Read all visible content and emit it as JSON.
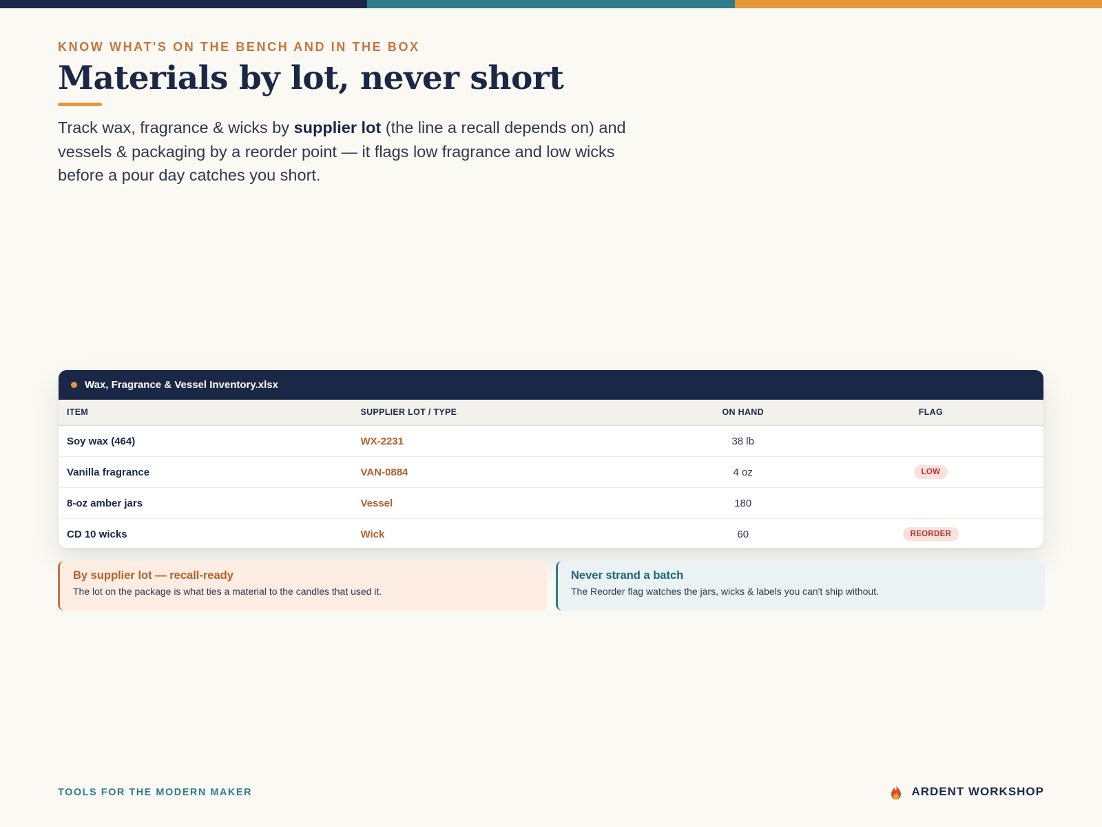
{
  "colors": {
    "navy": "#1b2747",
    "teal": "#2e7d8a",
    "orange": "#e8963a",
    "rust": "#c6743e",
    "flag_bg": "#fbe1dd",
    "flag_text": "#b3352c"
  },
  "header": {
    "eyebrow": "KNOW WHAT'S ON THE BENCH AND IN THE BOX",
    "title": "Materials by lot, never short",
    "intro_before": "Track wax, fragrance & wicks by ",
    "intro_bold": "supplier lot",
    "intro_after": " (the line a recall depends on) and vessels & packaging by a reorder point — it flags low fragrance and low wicks before a pour day catches you short."
  },
  "sheet": {
    "filename": "Wax, Fragrance & Vessel Inventory.xlsx",
    "columns": [
      "ITEM",
      "SUPPLIER LOT / TYPE",
      "ON HAND",
      "FLAG"
    ],
    "rows": [
      {
        "item": "Soy wax (464)",
        "lot": "WX-2231",
        "on_hand": "38 lb",
        "flag": ""
      },
      {
        "item": "Vanilla fragrance",
        "lot": "VAN-0884",
        "on_hand": "4 oz",
        "flag": "LOW"
      },
      {
        "item": "8-oz amber jars",
        "lot": "Vessel",
        "on_hand": "180",
        "flag": ""
      },
      {
        "item": "CD 10 wicks",
        "lot": "Wick",
        "on_hand": "60",
        "flag": "REORDER"
      }
    ]
  },
  "callouts": {
    "left": {
      "title": "By supplier lot — recall-ready",
      "body": "The lot on the package is what ties a material to the candles that used it."
    },
    "right": {
      "title": "Never strand a batch",
      "body": "The Reorder flag watches the jars, wicks & labels you can't ship without."
    }
  },
  "footer": {
    "tagline": "TOOLS FOR THE MODERN MAKER",
    "brand": "ARDENT WORKSHOP",
    "brand_icon": "flame-icon"
  }
}
